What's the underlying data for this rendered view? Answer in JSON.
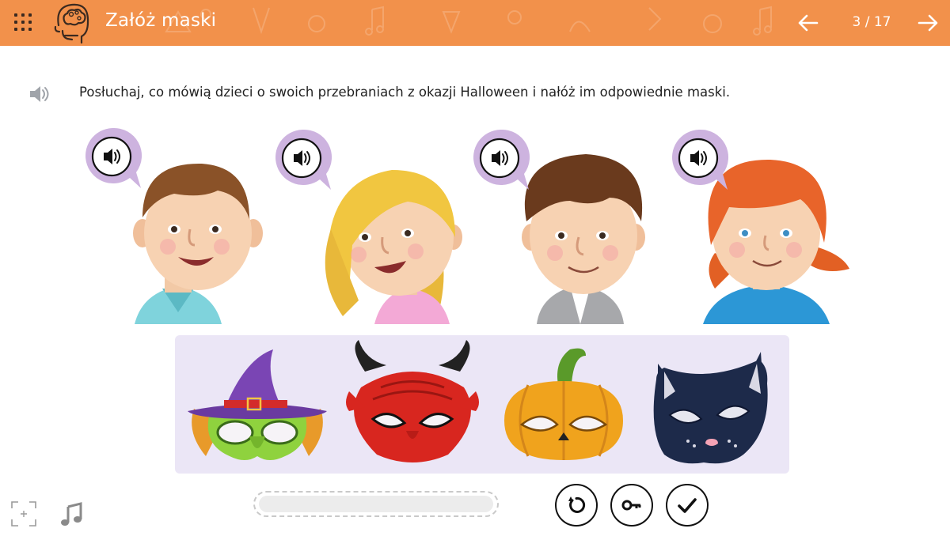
{
  "header": {
    "title": "Załóż maski",
    "page_counter": "3 / 17",
    "background_color": "#f2914b",
    "menu_icon": "grid-menu-icon",
    "logo_icon": "brain-head-icon",
    "prev_icon": "arrow-left-icon",
    "next_icon": "arrow-right-icon"
  },
  "instruction": {
    "text": "Posłuchaj, co mówią dzieci o swoich przebraniach z okazji Halloween i nałóż im odpowiednie maski.",
    "audio_icon": "speaker-icon"
  },
  "children": [
    {
      "id": "boy-1",
      "hair": "brown",
      "shirt": "light-blue collar shirt",
      "audio_icon": "speaker-bubble-icon"
    },
    {
      "id": "girl-1",
      "hair": "blonde",
      "shirt": "pink top",
      "audio_icon": "speaker-bubble-icon"
    },
    {
      "id": "boy-2",
      "hair": "dark brown",
      "shirt": "grey hoodie",
      "audio_icon": "speaker-bubble-icon"
    },
    {
      "id": "girl-2",
      "hair": "red",
      "shirt": "blue top",
      "audio_icon": "speaker-bubble-icon"
    }
  ],
  "masks": [
    {
      "id": "witch-mask",
      "label": "witch"
    },
    {
      "id": "devil-mask",
      "label": "devil"
    },
    {
      "id": "pumpkin-mask",
      "label": "pumpkin"
    },
    {
      "id": "cat-mask",
      "label": "cat"
    }
  ],
  "controls": {
    "fullscreen_icon": "fullscreen-icon",
    "music_icon": "music-note-icon",
    "reset_icon": "reset-icon",
    "key_icon": "key-icon",
    "check_icon": "check-icon"
  },
  "colors": {
    "accent": "#f2914b",
    "bubble": "#cdb3df",
    "tray": "#ebe6f6"
  }
}
